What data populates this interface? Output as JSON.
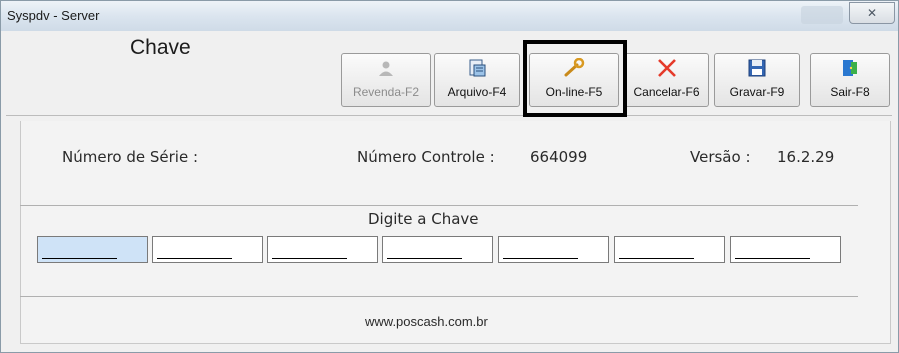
{
  "window": {
    "title": "Syspdv - Server",
    "close_glyph": "✕"
  },
  "header": {
    "heading": "Chave"
  },
  "toolbar": [
    {
      "id": "revenda",
      "label": "Revenda-F2",
      "icon": "user-icon",
      "enabled": false
    },
    {
      "id": "arquivo",
      "label": "Arquivo-F4",
      "icon": "file-icon",
      "enabled": true
    },
    {
      "id": "online",
      "label": "On-line-F5",
      "icon": "wrench-icon",
      "enabled": true
    },
    {
      "id": "cancelar",
      "label": "Cancelar-F6",
      "icon": "cancel-x-icon",
      "enabled": true
    },
    {
      "id": "gravar",
      "label": "Gravar-F9",
      "icon": "floppy-disk-icon",
      "enabled": true
    },
    {
      "id": "sair",
      "label": "Sair-F8",
      "icon": "exit-door-icon",
      "enabled": true
    }
  ],
  "info": {
    "serial_label": "Número de Série :",
    "control_label": "Número Controle :",
    "control_value": "664099",
    "version_label": "Versão :",
    "version_value": "16.2.29"
  },
  "key_entry": {
    "prompt": "Digite a Chave",
    "fields": [
      "",
      "",
      "",
      "",
      "",
      "",
      ""
    ]
  },
  "footer": {
    "url": "www.poscash.com.br"
  },
  "colors": {
    "focus_border": "#000000",
    "active_field": "#cfe3f7",
    "cancel_red": "#e53a2a"
  }
}
